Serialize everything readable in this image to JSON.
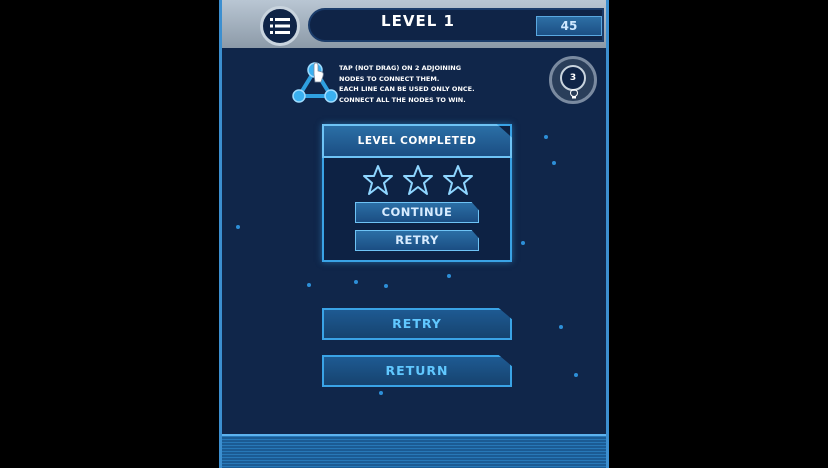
{
  "header": {
    "level_title": "LEVEL 1",
    "score": "45",
    "menu_icon": "list-menu-icon"
  },
  "instructions": {
    "lines": [
      "TAP (NOT DRAG) ON 2 ADJOINING",
      "NODES TO CONNECT THEM.",
      "EACH LINE CAN BE USED ONLY ONCE.",
      "CONNECT ALL THE NODES TO WIN."
    ],
    "icon": "triangle-nodes-tap-icon"
  },
  "hint": {
    "count": "3",
    "icon": "lightbulb-icon"
  },
  "dialog": {
    "title": "LEVEL COMPLETED",
    "stars_earned": 0,
    "stars_total": 3,
    "continue_label": "CONTINUE",
    "retry_label": "RETRY"
  },
  "buttons": {
    "retry_label": "RETRY",
    "return_label": "RETURN"
  },
  "colors": {
    "background": "#10264a",
    "accent": "#3aa3e6",
    "button_text": "#61c8ff"
  }
}
